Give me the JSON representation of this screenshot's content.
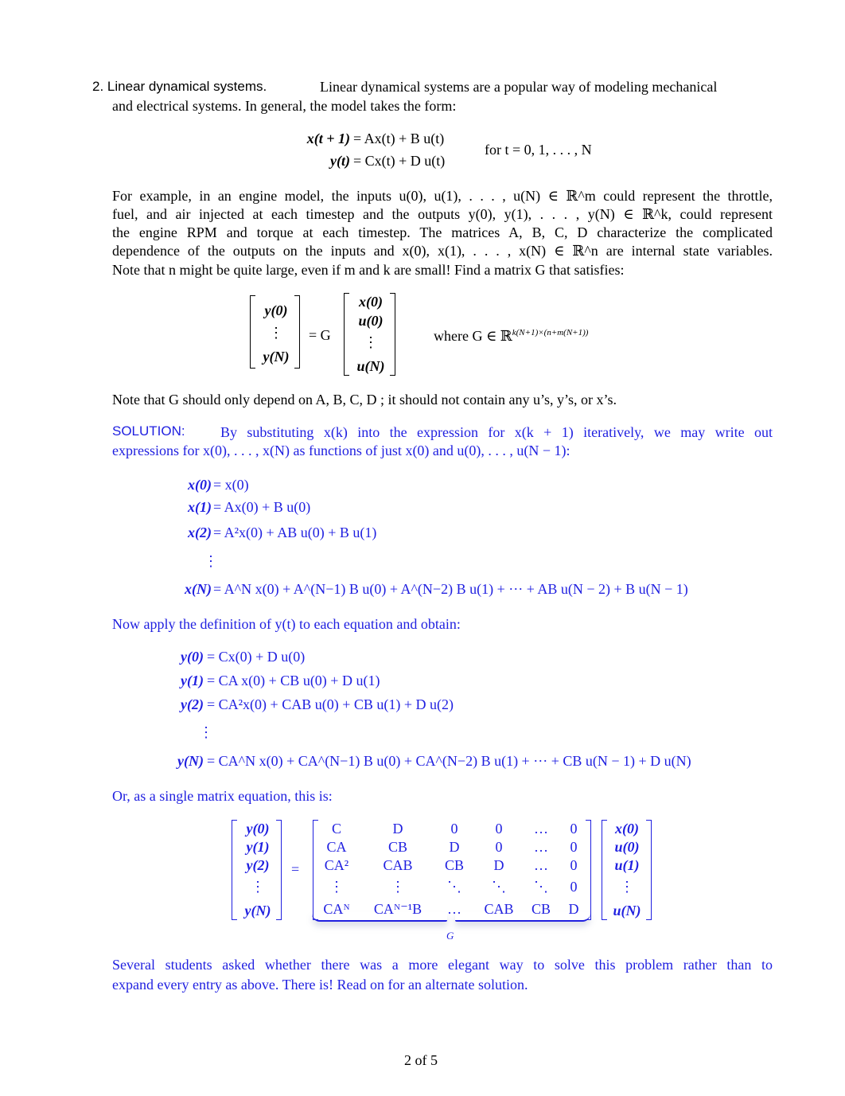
{
  "problem": {
    "number": "2.",
    "heading": "Linear dynamical systems.",
    "intro_line1": "Linear dynamical systems are a popular way of modeling mechanical",
    "intro_line2": "and electrical systems. In general, the model takes the form:",
    "model": {
      "eq1_lhs": "x(t + 1)",
      "eq1_rhs": "= Ax(t) + B u(t)",
      "eq2_lhs": "y(t)",
      "eq2_rhs": "= Cx(t) + D u(t)",
      "condition": "for t = 0, 1, . . . , N"
    },
    "para_lines": [
      "For example, in an engine model, the inputs u(0), u(1), . . . , u(N) ∈ ℝ^m could represent the throttle,",
      "fuel, and air injected at each timestep and the outputs y(0), y(1), . . . , y(N) ∈ ℝ^k, could represent",
      "the engine RPM and torque at each timestep. The matrices A, B, C, D characterize the complicated",
      "dependence of the outputs on the inputs and x(0), x(1), . . . , x(N) ∈ ℝ^n are internal state variables.",
      "Note that n might be quite large, even if m and k are small! Find a matrix G that satisfies:"
    ],
    "target_eq": {
      "lhs": [
        "y(0)",
        "⋮",
        "y(N)"
      ],
      "equals": "= G",
      "rhs": [
        "x(0)",
        "u(0)",
        "⋮",
        "u(N)"
      ],
      "where": "where G ∈ ℝ",
      "where_sup": "k(N+1)×(n+m(N+1))"
    },
    "note": "Note that G should only depend on A, B, C, D ; it should not contain any u’s, y’s, or x’s."
  },
  "solution": {
    "label": "SOLUTION:",
    "line1": "By substituting x(k) into the expression for x(k + 1) iteratively, we may write out",
    "line2": "expressions for x(0), . . . , x(N) as functions of just x(0) and u(0), . . . , u(N − 1):",
    "x_eqs": [
      {
        "lhs": "x(0)",
        "rhs": "= x(0)"
      },
      {
        "lhs": "x(1)",
        "rhs": "= Ax(0) + B u(0)"
      },
      {
        "lhs": "x(2)",
        "rhs": "= A²x(0) + AB u(0) + B u(1)"
      },
      {
        "lhs": "⋮",
        "rhs": ""
      },
      {
        "lhs": "x(N)",
        "rhs": "= A^N x(0) + A^(N−1) B u(0) + A^(N−2) B u(1) + ··· + AB u(N − 2) + B u(N − 1)"
      }
    ],
    "apply_text": "Now apply the definition of y(t) to each equation and obtain:",
    "y_eqs": [
      {
        "lhs": "y(0)",
        "rhs": "= Cx(0) + D u(0)"
      },
      {
        "lhs": "y(1)",
        "rhs": "= CA x(0) + CB u(0) + D u(1)"
      },
      {
        "lhs": "y(2)",
        "rhs": "= CA²x(0) + CAB u(0) + CB u(1) + D u(2)"
      },
      {
        "lhs": "⋮",
        "rhs": ""
      },
      {
        "lhs": "y(N)",
        "rhs": "= CA^N x(0) + CA^(N−1) B u(0) + CA^(N−2) B u(1) + ··· + CB u(N − 1) + D u(N)"
      }
    ],
    "matrix_intro": "Or, as a single matrix equation, this is:",
    "matrix_eq": {
      "lhs": [
        "y(0)",
        "y(1)",
        "y(2)",
        "⋮",
        "y(N)"
      ],
      "G_rows": [
        [
          "C",
          "D",
          "0",
          "0",
          "…",
          "0"
        ],
        [
          "CA",
          "CB",
          "D",
          "0",
          "…",
          "0"
        ],
        [
          "CA²",
          "CAB",
          "CB",
          "D",
          "…",
          "0"
        ],
        [
          "⋮",
          "⋮",
          "⋱",
          "⋱",
          "⋱",
          "0"
        ],
        [
          "CAᴺ",
          "CAᴺ⁻¹B",
          "…",
          "CAB",
          "CB",
          "D"
        ]
      ],
      "rhs": [
        "x(0)",
        "u(0)",
        "u(1)",
        "⋮",
        "u(N)"
      ],
      "brace_label": "G"
    },
    "closing_line1": "Several students asked whether there was a more elegant way to solve this problem rather than to",
    "closing_line2": "expand every entry as above. There is! Read on for an alternate solution."
  },
  "footer": {
    "page": "2 of 5"
  }
}
